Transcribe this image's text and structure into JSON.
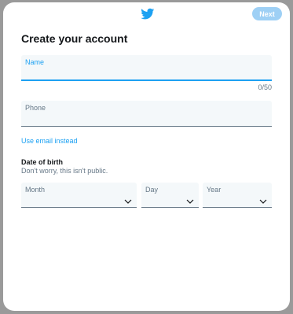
{
  "header": {
    "logo_icon": "twitter-bird-icon",
    "next_label": "Next",
    "brand_color": "#1da1f2",
    "next_disabled_color": "#9ed0f5"
  },
  "title": "Create your account",
  "name_field": {
    "label": "Name",
    "value": "",
    "counter": "0/50"
  },
  "phone_field": {
    "label": "Phone",
    "value": ""
  },
  "use_email_link": "Use email instead",
  "dob": {
    "title": "Date of birth",
    "subtitle": "Don't worry, this isn't public.",
    "month_label": "Month",
    "day_label": "Day",
    "year_label": "Year",
    "chevron_icon": "chevron-down-icon"
  }
}
